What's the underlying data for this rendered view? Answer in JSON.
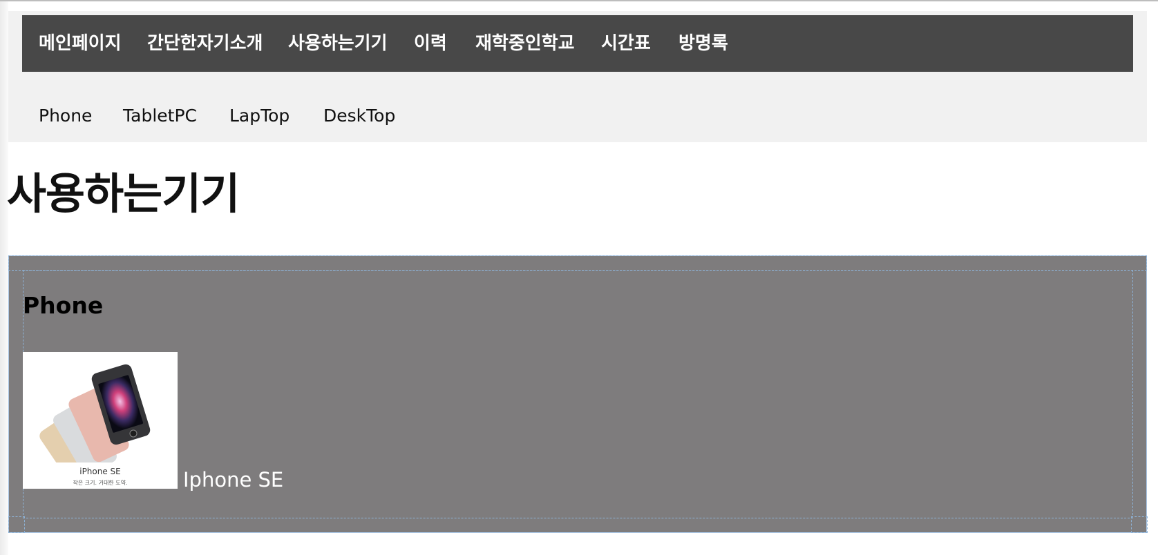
{
  "main_nav": {
    "items": [
      {
        "label": "메인페이지"
      },
      {
        "label": "간단한자기소개"
      },
      {
        "label": "사용하는기기"
      },
      {
        "label": "이력"
      },
      {
        "label": "재학중인학교"
      },
      {
        "label": "시간표"
      },
      {
        "label": "방명록"
      }
    ]
  },
  "sub_nav": {
    "items": [
      {
        "label": "Phone"
      },
      {
        "label": "TabletPC"
      },
      {
        "label": "LapTop"
      },
      {
        "label": "DeskTop"
      }
    ]
  },
  "page": {
    "title": "사용하는기기"
  },
  "section": {
    "title": "Phone",
    "device": {
      "name": "Iphone SE",
      "image_caption": "iPhone SE",
      "image_tagline": "작은 크기. 거대한 도약."
    }
  },
  "colors": {
    "nav_background": "#484848",
    "header_background": "#f1f1f1",
    "section_background": "#7e7c7d",
    "outline_dashed": "#8eb3d8"
  },
  "icons": {
    "device_image": "iphone-se-product-icon"
  }
}
